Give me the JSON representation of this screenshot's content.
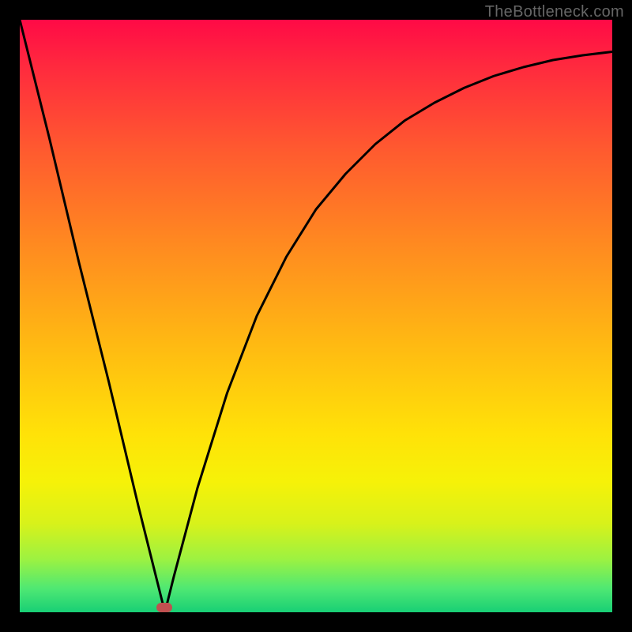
{
  "watermark": "TheBottleneck.com",
  "colors": {
    "frame": "#000000",
    "curve": "#000000",
    "marker": "#c05050"
  },
  "chart_data": {
    "type": "line",
    "title": "",
    "xlabel": "",
    "ylabel": "",
    "xlim": [
      0,
      100
    ],
    "ylim": [
      0,
      100
    ],
    "grid": false,
    "legend": false,
    "series": [
      {
        "name": "curve",
        "x": [
          0,
          5,
          10,
          15,
          20,
          24.5,
          25,
          26,
          30,
          35,
          40,
          45,
          50,
          55,
          60,
          65,
          70,
          75,
          80,
          85,
          90,
          95,
          100
        ],
        "y": [
          100,
          80,
          59,
          39,
          18,
          0,
          2,
          6,
          21,
          37,
          50,
          60,
          68,
          74,
          79,
          83,
          86,
          88.5,
          90.5,
          92,
          93.2,
          94,
          94.6
        ]
      }
    ],
    "marker": {
      "x": 24.5,
      "y": 0
    }
  }
}
